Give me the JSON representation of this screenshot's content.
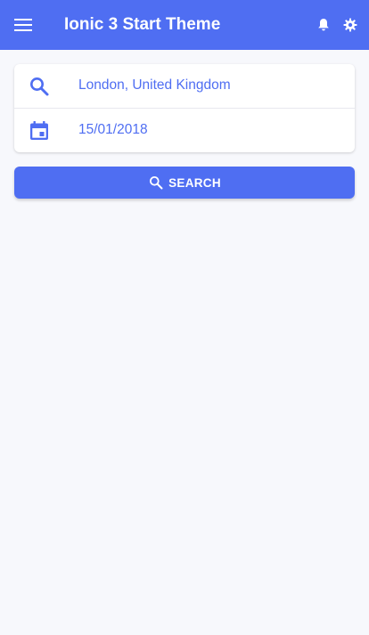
{
  "header": {
    "title": "Ionic 3 Start Theme",
    "menu_icon": "menu-icon",
    "notification_icon": "bell-icon",
    "settings_icon": "gear-icon"
  },
  "form": {
    "location_value": "London, United Kingdom",
    "location_icon": "search-icon",
    "date_value": "15/01/2018",
    "date_icon": "calendar-icon"
  },
  "search_button": {
    "label": "SEARCH",
    "icon": "search-icon"
  },
  "colors": {
    "primary": "#4f6ef2",
    "background": "#f7f8fc",
    "card": "#ffffff",
    "header_text": "#ffffff"
  }
}
